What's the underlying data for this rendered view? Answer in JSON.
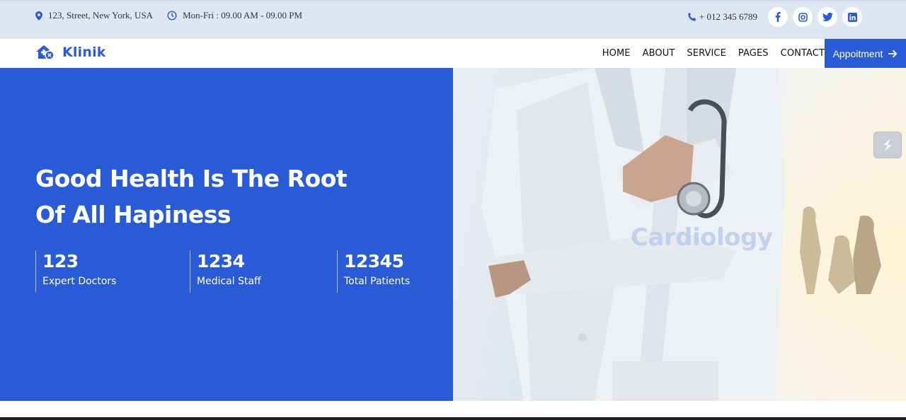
{
  "topbar": {
    "address": "123, Street, New York, USA",
    "hours": "Mon-Fri : 09.00 AM - 09.00 PM",
    "phone": "+ 012 345 6789",
    "socials": [
      "facebook-icon",
      "instagram-icon",
      "twitter-icon",
      "linkedin-icon"
    ]
  },
  "brand": {
    "name": "Klinik",
    "color": "#2a5bd7"
  },
  "nav": {
    "items": [
      "HOME",
      "ABOUT",
      "SERVICE",
      "PAGES",
      "CONTACT"
    ],
    "cta": "Appoitment"
  },
  "hero": {
    "headline_line1": "Good Health Is The Root",
    "headline_line2": "Of All Hapiness",
    "stats": [
      {
        "value": "123",
        "label": "Expert Doctors"
      },
      {
        "value": "1234",
        "label": "Medical Staff"
      },
      {
        "value": "12345",
        "label": "Total Patients"
      }
    ],
    "slide_caption": "Cardiology"
  },
  "colors": {
    "primary": "#2a5bd7",
    "topbar_bg": "#dfe6f3"
  }
}
